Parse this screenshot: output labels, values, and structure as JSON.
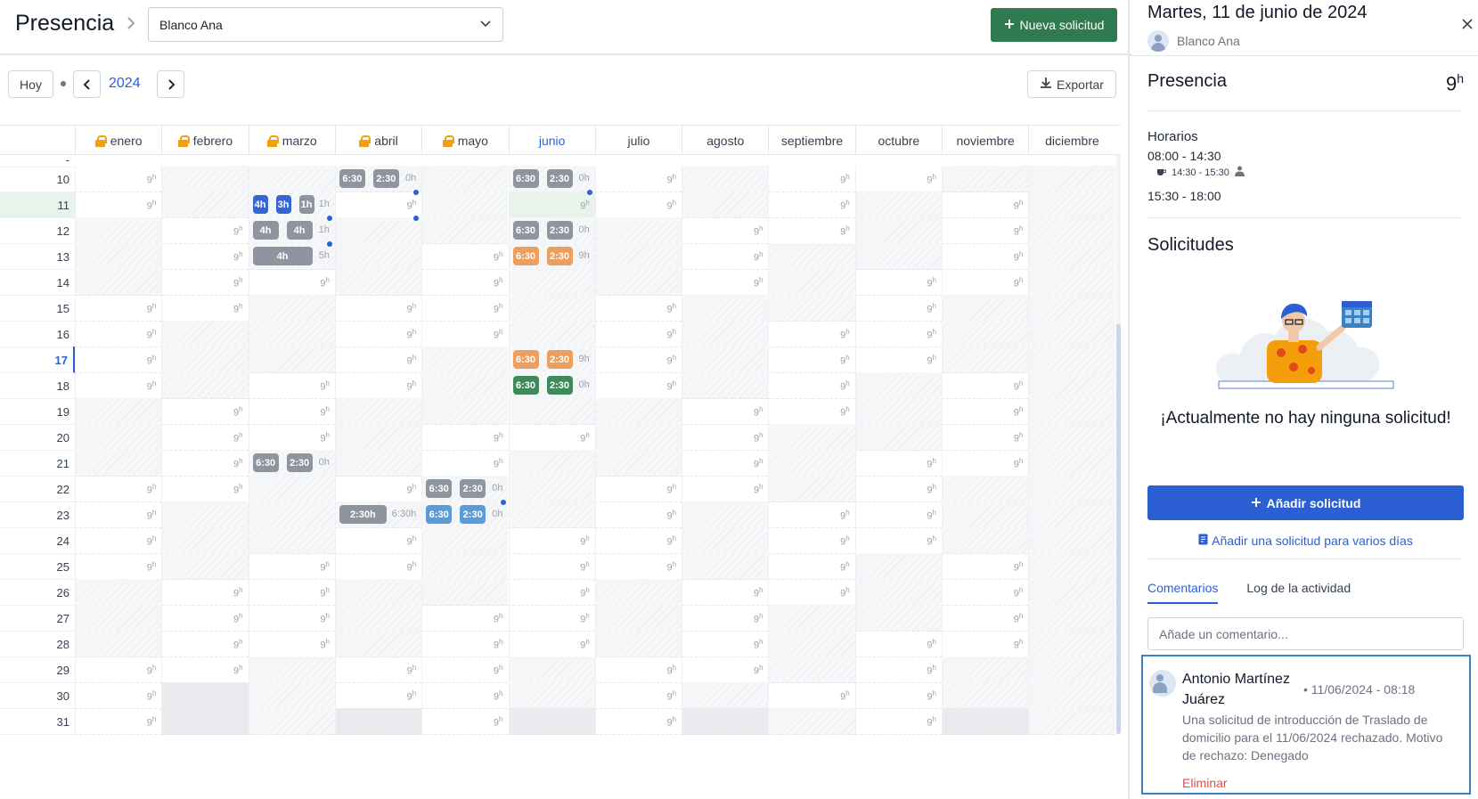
{
  "header": {
    "title": "Presencia",
    "employee_select": "Blanco Ana",
    "new_request_label": "Nueva solicitud"
  },
  "toolbar": {
    "today_label": "Hoy",
    "year": "2024",
    "export_label": "Exportar"
  },
  "calendar": {
    "months": [
      {
        "label": "enero",
        "locked": true
      },
      {
        "label": "febrero",
        "locked": true
      },
      {
        "label": "marzo",
        "locked": true
      },
      {
        "label": "abril",
        "locked": true
      },
      {
        "label": "mayo",
        "locked": true
      },
      {
        "label": "junio",
        "locked": false,
        "current": true
      },
      {
        "label": "julio",
        "locked": false
      },
      {
        "label": "agosto",
        "locked": false
      },
      {
        "label": "septiembre",
        "locked": false
      },
      {
        "label": "octubre",
        "locked": false
      },
      {
        "label": "noviembre",
        "locked": false
      },
      {
        "label": "diciembre",
        "locked": false
      }
    ],
    "first_day_label": "-",
    "today_row": "11",
    "marked_row": "17",
    "rows": [
      {
        "day": "10",
        "cells": [
          "9",
          "h",
          "h",
          "h",
          "h",
          "h",
          "9",
          "h",
          "9",
          "9",
          "h",
          "h"
        ]
      },
      {
        "day": "11",
        "cells": [
          "9",
          "h",
          "h",
          "9",
          "h",
          "sel",
          "9",
          "h",
          "9",
          "h",
          "9",
          "h"
        ]
      },
      {
        "day": "12",
        "cells": [
          "h",
          "9",
          "h",
          "h",
          "h",
          "h",
          "h",
          "9",
          "9",
          "h",
          "9",
          "h"
        ]
      },
      {
        "day": "13",
        "cells": [
          "h",
          "9",
          "h",
          "h",
          "9",
          "h",
          "h",
          "9",
          "h",
          "h",
          "9",
          "h"
        ]
      },
      {
        "day": "14",
        "cells": [
          "h",
          "9",
          "9",
          "h",
          "9",
          "h",
          "h",
          "9",
          "h",
          "9",
          "9",
          "h"
        ]
      },
      {
        "day": "15",
        "cells": [
          "9",
          "9",
          "h",
          "9",
          "9",
          "h",
          "9",
          "h",
          "h",
          "9",
          "h",
          "h"
        ]
      },
      {
        "day": "16",
        "cells": [
          "9",
          "h",
          "h",
          "9",
          "9",
          "h",
          "9",
          "h",
          "9",
          "9",
          "h",
          "h"
        ]
      },
      {
        "day": "17",
        "cells": [
          "9",
          "h",
          "h",
          "9",
          "h",
          "h",
          "9",
          "h",
          "9",
          "9",
          "h",
          "h"
        ]
      },
      {
        "day": "18",
        "cells": [
          "9",
          "h",
          "9",
          "9",
          "h",
          "h",
          "9",
          "h",
          "9",
          "h",
          "9",
          "h"
        ]
      },
      {
        "day": "19",
        "cells": [
          "h",
          "9",
          "9",
          "h",
          "h",
          "h",
          "h",
          "9",
          "9",
          "h",
          "9",
          "h"
        ]
      },
      {
        "day": "20",
        "cells": [
          "h",
          "9",
          "9",
          "h",
          "9",
          "9",
          "h",
          "9",
          "h",
          "h",
          "9",
          "h"
        ]
      },
      {
        "day": "21",
        "cells": [
          "h",
          "9",
          "h",
          "h",
          "9",
          "h",
          "h",
          "9",
          "h",
          "9",
          "9",
          "h"
        ]
      },
      {
        "day": "22",
        "cells": [
          "9",
          "9",
          "h",
          "9",
          "h",
          "h",
          "9",
          "9",
          "h",
          "9",
          "h",
          "h"
        ]
      },
      {
        "day": "23",
        "cells": [
          "9",
          "h",
          "h",
          "h",
          "h",
          "h",
          "9",
          "h",
          "9",
          "9",
          "h",
          "h"
        ]
      },
      {
        "day": "24",
        "cells": [
          "9",
          "h",
          "h",
          "9",
          "h",
          "9",
          "9",
          "h",
          "9",
          "9",
          "h",
          "h"
        ]
      },
      {
        "day": "25",
        "cells": [
          "9",
          "h",
          "9",
          "9",
          "h",
          "9",
          "9",
          "h",
          "9",
          "h",
          "9",
          "h"
        ]
      },
      {
        "day": "26",
        "cells": [
          "h",
          "9",
          "9",
          "h",
          "h",
          "9",
          "h",
          "9",
          "9",
          "h",
          "9",
          "h"
        ]
      },
      {
        "day": "27",
        "cells": [
          "h",
          "9",
          "9",
          "h",
          "9",
          "9",
          "h",
          "9",
          "h",
          "h",
          "9",
          "h"
        ]
      },
      {
        "day": "28",
        "cells": [
          "h",
          "9",
          "9",
          "h",
          "9",
          "9",
          "h",
          "9",
          "h",
          "9",
          "9",
          "h"
        ]
      },
      {
        "day": "29",
        "cells": [
          "9",
          "9",
          "h",
          "9",
          "9",
          "h",
          "9",
          "9",
          "h",
          "9",
          "h",
          "h"
        ]
      },
      {
        "day": "30",
        "cells": [
          "9",
          "x",
          "h",
          "9",
          "9",
          "h",
          "9",
          "h",
          "9",
          "9",
          "h",
          "h"
        ]
      },
      {
        "day": "31",
        "cells": [
          "9",
          "x",
          "h",
          "x",
          "9",
          "x",
          "9",
          "x",
          "h",
          "9",
          "x",
          "h"
        ]
      }
    ],
    "hours_unit": "h",
    "chips": [
      {
        "row": 0,
        "col": 3,
        "offset": 5,
        "width": 29,
        "label": "6:30",
        "color": "gray"
      },
      {
        "row": 0,
        "col": 3,
        "offset": 43,
        "width": 29,
        "label": "2:30",
        "color": "gray"
      },
      {
        "row": 0,
        "col": 3,
        "offset": 0,
        "width": 0,
        "label": "0h",
        "color": "text"
      },
      {
        "row": 0,
        "col": 5,
        "offset": 5,
        "width": 29,
        "label": "6:30",
        "color": "gray"
      },
      {
        "row": 0,
        "col": 5,
        "offset": 43,
        "width": 29,
        "label": "2:30",
        "color": "gray"
      },
      {
        "row": 0,
        "col": 5,
        "offset": 0,
        "width": 0,
        "label": "0h",
        "color": "text"
      },
      {
        "row": 1,
        "col": 2,
        "offset": 5,
        "width": 17,
        "label": "4h",
        "color": "blue"
      },
      {
        "row": 1,
        "col": 2,
        "offset": 31,
        "width": 17,
        "label": "3h",
        "color": "blue"
      },
      {
        "row": 1,
        "col": 2,
        "offset": 57,
        "width": 17,
        "label": "1h",
        "color": "gray"
      },
      {
        "row": 1,
        "col": 2,
        "offset": 0,
        "width": 0,
        "label": "1h",
        "color": "text"
      },
      {
        "row": 2,
        "col": 2,
        "offset": 5,
        "width": 29,
        "label": "4h",
        "color": "gray"
      },
      {
        "row": 2,
        "col": 2,
        "offset": 43,
        "width": 29,
        "label": "4h",
        "color": "gray"
      },
      {
        "row": 2,
        "col": 2,
        "offset": 0,
        "width": 0,
        "label": "1h",
        "color": "text"
      },
      {
        "row": 2,
        "col": 5,
        "offset": 5,
        "width": 29,
        "label": "6:30",
        "color": "gray"
      },
      {
        "row": 2,
        "col": 5,
        "offset": 43,
        "width": 29,
        "label": "2:30",
        "color": "gray"
      },
      {
        "row": 2,
        "col": 5,
        "offset": 0,
        "width": 0,
        "label": "0h",
        "color": "text"
      },
      {
        "row": 3,
        "col": 2,
        "offset": 5,
        "width": 67,
        "label": "4h",
        "color": "gray"
      },
      {
        "row": 3,
        "col": 2,
        "offset": 0,
        "width": 0,
        "label": "5h",
        "color": "text"
      },
      {
        "row": 3,
        "col": 5,
        "offset": 5,
        "width": 29,
        "label": "6:30",
        "color": "orange"
      },
      {
        "row": 3,
        "col": 5,
        "offset": 43,
        "width": 29,
        "label": "2:30",
        "color": "orange"
      },
      {
        "row": 3,
        "col": 5,
        "offset": 0,
        "width": 0,
        "label": "9h",
        "color": "text"
      },
      {
        "row": 7,
        "col": 5,
        "offset": 5,
        "width": 29,
        "label": "6:30",
        "color": "orange"
      },
      {
        "row": 7,
        "col": 5,
        "offset": 43,
        "width": 29,
        "label": "2:30",
        "color": "orange"
      },
      {
        "row": 7,
        "col": 5,
        "offset": 0,
        "width": 0,
        "label": "9h",
        "color": "text"
      },
      {
        "row": 8,
        "col": 5,
        "offset": 5,
        "width": 29,
        "label": "6:30",
        "color": "green"
      },
      {
        "row": 8,
        "col": 5,
        "offset": 43,
        "width": 29,
        "label": "2:30",
        "color": "green"
      },
      {
        "row": 8,
        "col": 5,
        "offset": 0,
        "width": 0,
        "label": "0h",
        "color": "text"
      },
      {
        "row": 11,
        "col": 2,
        "offset": 5,
        "width": 29,
        "label": "6:30",
        "color": "gray"
      },
      {
        "row": 11,
        "col": 2,
        "offset": 43,
        "width": 29,
        "label": "2:30",
        "color": "gray"
      },
      {
        "row": 11,
        "col": 2,
        "offset": 0,
        "width": 0,
        "label": "0h",
        "color": "text"
      },
      {
        "row": 12,
        "col": 4,
        "offset": 5,
        "width": 29,
        "label": "6:30",
        "color": "gray"
      },
      {
        "row": 12,
        "col": 4,
        "offset": 43,
        "width": 29,
        "label": "2:30",
        "color": "gray"
      },
      {
        "row": 12,
        "col": 4,
        "offset": 0,
        "width": 0,
        "label": "0h",
        "color": "text"
      },
      {
        "row": 13,
        "col": 3,
        "offset": 5,
        "width": 53,
        "label": "2:30h",
        "color": "gray"
      },
      {
        "row": 13,
        "col": 3,
        "offset": 0,
        "width": 0,
        "label": "6:30h",
        "color": "text"
      },
      {
        "row": 13,
        "col": 4,
        "offset": 5,
        "width": 29,
        "label": "6:30",
        "color": "lblue"
      },
      {
        "row": 13,
        "col": 4,
        "offset": 43,
        "width": 29,
        "label": "2:30",
        "color": "lblue"
      },
      {
        "row": 13,
        "col": 4,
        "offset": 0,
        "width": 0,
        "label": "0h",
        "color": "text"
      }
    ],
    "dots": [
      {
        "row": 1,
        "col": 3
      },
      {
        "row": 1,
        "col": 5
      },
      {
        "row": 2,
        "col": 2
      },
      {
        "row": 2,
        "col": 3
      },
      {
        "row": 3,
        "col": 2
      },
      {
        "row": 13,
        "col": 4
      }
    ]
  },
  "panel": {
    "date": "Martes, 11 de junio de 2024",
    "user": "Blanco Ana",
    "presence_title": "Presencia",
    "presence_hours": "9",
    "presence_unit": "h",
    "schedules_title": "Horarios",
    "schedule_1": "08:00 - 14:30",
    "break_range": "14:30 - 15:30",
    "schedule_2": "15:30 - 18:00",
    "requests_title": "Solicitudes",
    "empty_message": "¡Actualmente no hay ninguna solicitud!",
    "add_request_label": "Añadir solicitud",
    "multi_day_label": "Añadir una solicitud para varios días",
    "tabs": [
      "Comentarios",
      "Log de la actividad"
    ],
    "comment_placeholder": "Añade un comentario...",
    "comment": {
      "author": "Antonio Martínez Juárez",
      "date": "• 11/06/2024 - 08:18",
      "body": "Una solicitud de introducción de Traslado de domicilio para el 11/06/2024 rechazado. Motivo de rechazo: Denegado",
      "delete_label": "Eliminar"
    }
  },
  "colors": {
    "accent": "#2c5fd4",
    "primary_green": "#2f7a4f",
    "danger": "#d9534f"
  }
}
